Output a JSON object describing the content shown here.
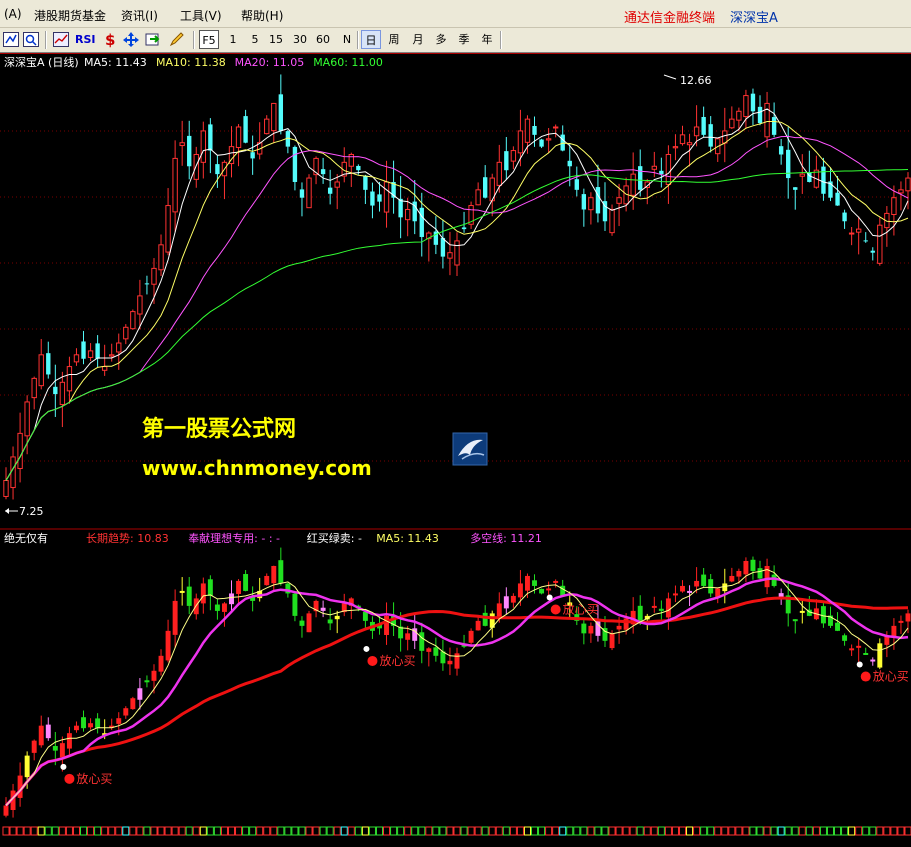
{
  "menu": {
    "items": [
      "(A)",
      "港股期货基金",
      "资讯(I)",
      "工具(V)",
      "帮助(H)"
    ],
    "brand": "通达信金融终端",
    "stock": "深深宝A"
  },
  "toolbar": {
    "rsi_label": "RSI",
    "f5_label": "F5",
    "periods": [
      "1",
      "5",
      "15",
      "30",
      "60",
      "N"
    ],
    "period_cn": [
      "日",
      "周",
      "月",
      "多",
      "季",
      "年"
    ],
    "selected_period": "日"
  },
  "main_panel": {
    "title": "深深宝A (日线)",
    "ma_labels": [
      {
        "text": "MA5: 11.43",
        "color": "#ffffff"
      },
      {
        "text": "MA10: 11.38",
        "color": "#ffff66"
      },
      {
        "text": "MA20: 11.05",
        "color": "#ff55ff"
      },
      {
        "text": "MA60: 11.00",
        "color": "#33ff33"
      }
    ],
    "high_label": "12.66",
    "low_label": "7.25",
    "watermark_title": "第一股票公式网",
    "watermark_url": "www.chnmoney.com"
  },
  "indicator_panel": {
    "title": "绝无仅有",
    "labels": [
      {
        "text": "长期趋势: 10.83",
        "color": "#ff3333"
      },
      {
        "text": "奉献理想专用: - : -",
        "color": "#ff55ff"
      },
      {
        "text": "红买绿卖: -",
        "color": "#ffffff"
      },
      {
        "text": "MA5: 11.43",
        "color": "#ffff66"
      },
      {
        "text": "多空线: 11.21",
        "color": "#ff55ff"
      }
    ],
    "signal_label": "放心买",
    "signals": [
      9,
      52,
      78,
      122,
      159,
      193
    ]
  },
  "chart_data": {
    "type": "candlestick",
    "title": "深深宝A (日线)",
    "y_range": [
      7.25,
      12.66
    ],
    "closes": [
      7.6,
      7.9,
      8.2,
      8.6,
      8.9,
      9.2,
      8.95,
      8.7,
      8.85,
      9.05,
      9.2,
      9.15,
      9.25,
      9.15,
      9.05,
      9.2,
      9.35,
      9.55,
      9.75,
      9.95,
      10.1,
      10.3,
      10.6,
      11.1,
      11.7,
      11.9,
      11.6,
      11.75,
      12.05,
      11.8,
      11.5,
      11.65,
      11.85,
      12.1,
      11.9,
      11.7,
      11.9,
      12.2,
      12.4,
      12.05,
      11.85,
      11.4,
      11.2,
      11.45,
      11.7,
      11.5,
      11.25,
      11.4,
      11.65,
      11.75,
      11.55,
      11.3,
      11.1,
      11.15,
      11.4,
      11.2,
      10.95,
      11.05,
      10.9,
      10.7,
      10.75,
      10.6,
      10.45,
      10.5,
      10.65,
      10.8,
      11.1,
      11.3,
      11.2,
      11.45,
      11.65,
      11.55,
      11.8,
      12.05,
      12.2,
      12.0,
      11.85,
      11.95,
      12.1,
      11.8,
      11.6,
      11.3,
      11.05,
      11.2,
      11.0,
      10.9,
      11.05,
      11.2,
      11.35,
      11.5,
      11.3,
      11.4,
      11.6,
      11.5,
      11.75,
      11.85,
      12.0,
      11.9,
      12.1,
      12.0,
      11.85,
      11.95,
      12.05,
      12.2,
      12.3,
      12.5,
      12.3,
      12.15,
      12.4,
      12.0,
      11.75,
      11.45,
      11.3,
      11.5,
      11.4,
      11.55,
      11.25,
      11.2,
      11.1,
      10.9,
      10.75,
      10.8,
      10.65,
      10.5,
      10.85,
      11.0,
      11.2,
      11.3,
      11.45
    ],
    "ma_periods": [
      5,
      10,
      20,
      60
    ],
    "ma_last": {
      "MA5": 11.43,
      "MA10": 11.38,
      "MA20": 11.05,
      "MA60": 11.0
    }
  }
}
